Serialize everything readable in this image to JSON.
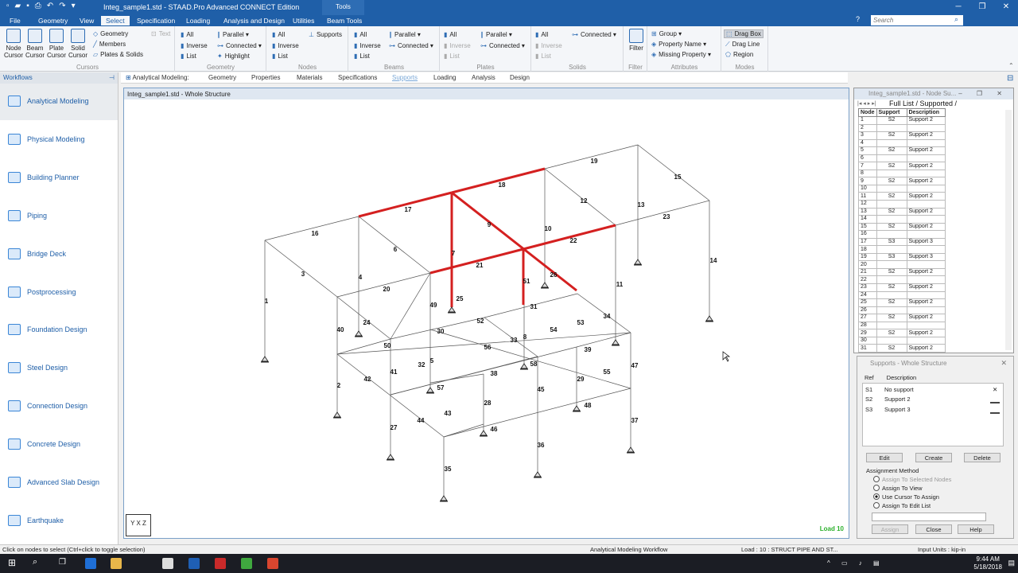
{
  "titlebar": {
    "title": "Integ_sample1.std - STAAD.Pro Advanced CONNECT Edition",
    "tools": "Tools"
  },
  "menu": {
    "tabs": [
      "File",
      "Geometry",
      "View",
      "Select",
      "Specification",
      "Loading",
      "Analysis and Design",
      "Utilities",
      "Beam Tools"
    ],
    "active": "Select",
    "search_placeholder": "Search"
  },
  "ribbon": {
    "cursors": {
      "items": [
        "Node Cursor",
        "Beam Cursor",
        "Plate Cursor",
        "Solid Cursor"
      ],
      "group": "Cursors"
    },
    "geometry": {
      "items": [
        "Geometry",
        "Members",
        "Plates & Solids"
      ],
      "text": "Text"
    },
    "geometry_group": {
      "all": "All",
      "inverse": "Inverse",
      "list": "List",
      "parallel": "Parallel",
      "connected": "Connected",
      "highlight": "Highlight",
      "group": "Geometry"
    },
    "nodes": {
      "all": "All",
      "inverse": "Inverse",
      "list": "List",
      "supports": "Supports",
      "group": "Nodes"
    },
    "beams": {
      "all": "All",
      "inverse": "Inverse",
      "list": "List",
      "parallel": "Parallel",
      "connected": "Connected",
      "group": "Beams"
    },
    "plates": {
      "all": "All",
      "inverse": "Inverse",
      "list": "List",
      "parallel": "Parallel",
      "connected": "Connected",
      "group": "Plates"
    },
    "solids": {
      "all": "All",
      "inverse": "Inverse",
      "list": "List",
      "connected": "Connected",
      "group": "Solids"
    },
    "filter": {
      "label": "Filter",
      "group": "Filter"
    },
    "attributes": {
      "group_btn": "Group",
      "property_name": "Property Name",
      "missing_property": "Missing Property",
      "group": "Attributes"
    },
    "modes": {
      "drag_box": "Drag Box",
      "drag_line": "Drag Line",
      "region": "Region",
      "group": "Modes"
    }
  },
  "workflows": {
    "header": "Workflows",
    "items": [
      "Analytical Modeling",
      "Physical Modeling",
      "Building Planner",
      "Piping",
      "Bridge Deck",
      "Postprocessing",
      "Foundation Design",
      "Steel Design",
      "Connection Design",
      "Concrete Design",
      "Advanced Slab Design",
      "Earthquake"
    ],
    "active": "Analytical Modeling"
  },
  "subtabs": {
    "prefix": "Analytical Modeling:",
    "items": [
      "Geometry",
      "Properties",
      "Materials",
      "Specifications",
      "Supports",
      "Loading",
      "Analysis",
      "Design"
    ],
    "active": "Supports"
  },
  "viewport": {
    "title": "Integ_sample1.std - Whole Structure",
    "load": "Load 10",
    "axes": "Y X Z"
  },
  "model": {
    "member_labels": [
      "1",
      "2",
      "3",
      "4",
      "5",
      "6",
      "7",
      "8",
      "9",
      "10",
      "11",
      "12",
      "13",
      "14",
      "15",
      "16",
      "17",
      "18",
      "19",
      "20",
      "21",
      "22",
      "23",
      "24",
      "25",
      "26",
      "27",
      "28",
      "29",
      "30",
      "31",
      "32",
      "33",
      "34",
      "35",
      "36",
      "37",
      "38",
      "39",
      "40",
      "41",
      "42",
      "43",
      "44",
      "45",
      "46",
      "47",
      "48",
      "49",
      "50",
      "51",
      "52",
      "53",
      "54",
      "55",
      "56",
      "57",
      "58"
    ],
    "highlight_color": "#d42020",
    "line_color": "#555555"
  },
  "node_summary": {
    "title": "Integ_sample1.std - Node Su...",
    "tabs": "Full List / Supported /",
    "columns": [
      "Node",
      "Support",
      "Description"
    ],
    "rows": [
      [
        "1",
        "S2",
        "Support 2"
      ],
      [
        "2",
        "",
        ""
      ],
      [
        "3",
        "S2",
        "Support 2"
      ],
      [
        "4",
        "",
        ""
      ],
      [
        "5",
        "S2",
        "Support 2"
      ],
      [
        "6",
        "",
        ""
      ],
      [
        "7",
        "S2",
        "Support 2"
      ],
      [
        "8",
        "",
        ""
      ],
      [
        "9",
        "S2",
        "Support 2"
      ],
      [
        "10",
        "",
        ""
      ],
      [
        "11",
        "S2",
        "Support 2"
      ],
      [
        "12",
        "",
        ""
      ],
      [
        "13",
        "S2",
        "Support 2"
      ],
      [
        "14",
        "",
        ""
      ],
      [
        "15",
        "S2",
        "Support 2"
      ],
      [
        "16",
        "",
        ""
      ],
      [
        "17",
        "S3",
        "Support 3"
      ],
      [
        "18",
        "",
        ""
      ],
      [
        "19",
        "S3",
        "Support 3"
      ],
      [
        "20",
        "",
        ""
      ],
      [
        "21",
        "S2",
        "Support 2"
      ],
      [
        "22",
        "",
        ""
      ],
      [
        "23",
        "S2",
        "Support 2"
      ],
      [
        "24",
        "",
        ""
      ],
      [
        "25",
        "S2",
        "Support 2"
      ],
      [
        "26",
        "",
        ""
      ],
      [
        "27",
        "S2",
        "Support 2"
      ],
      [
        "28",
        "",
        ""
      ],
      [
        "29",
        "S2",
        "Support 2"
      ],
      [
        "30",
        "",
        ""
      ],
      [
        "31",
        "S2",
        "Support 2"
      ]
    ]
  },
  "supports_panel": {
    "title": "Supports - Whole Structure",
    "col_ref": "Ref",
    "col_desc": "Description",
    "rows": [
      [
        "S1",
        "No support"
      ],
      [
        "S2",
        "Support 2"
      ],
      [
        "S3",
        "Support 3"
      ]
    ],
    "edit": "Edit",
    "create": "Create",
    "delete": "Delete",
    "method_label": "Assignment Method",
    "methods": [
      "Assign To Selected Nodes",
      "Assign To View",
      "Use Cursor To Assign",
      "Assign To Edit List"
    ],
    "selected_method": "Use Cursor To Assign",
    "assign": "Assign",
    "close": "Close",
    "help": "Help"
  },
  "status": {
    "hint": "Click on nodes to select (Ctrl+click to toggle selection)",
    "workflow": "Analytical Modeling Workflow",
    "load": "Load : 10 : STRUCT  PIPE AND ST...",
    "units": "Input Units : kip-in"
  },
  "taskbar": {
    "time": "9:44 AM",
    "date": "5/18/2018"
  }
}
